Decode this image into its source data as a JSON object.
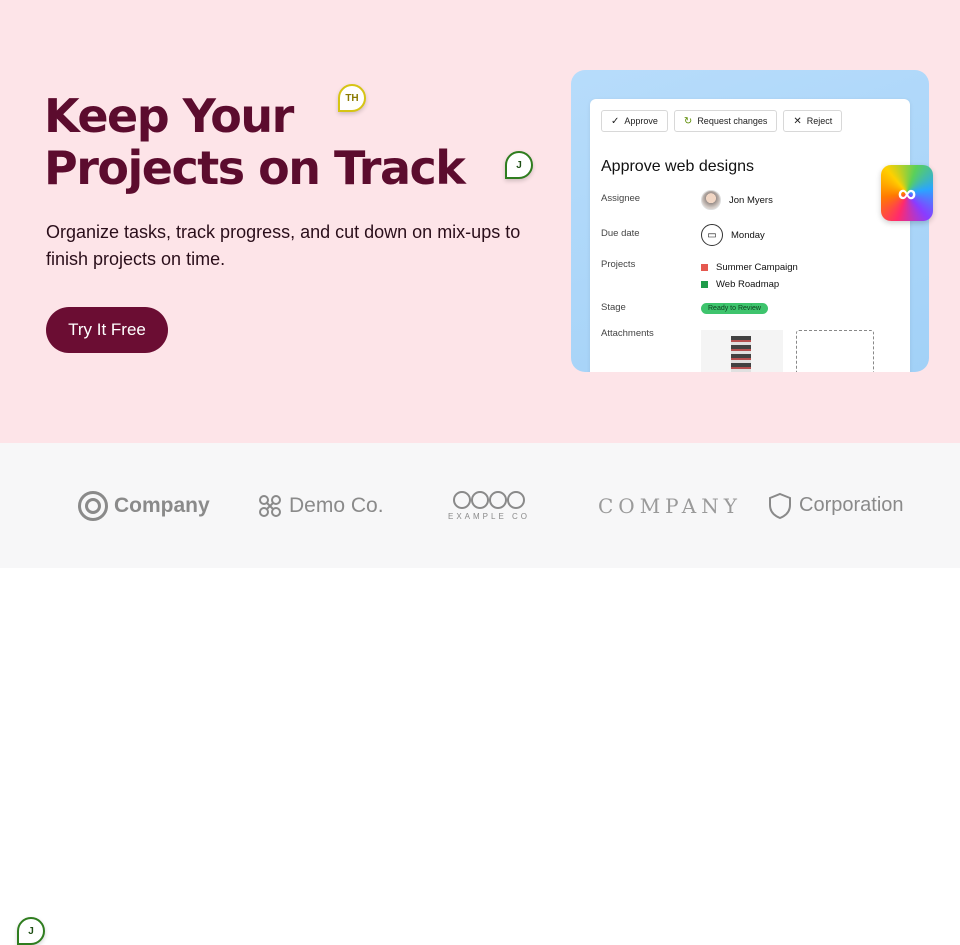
{
  "hero": {
    "headline": "Keep Your Projects on Track",
    "subtext": "Organize tasks, track progress, and cut down on mix-ups to finish projects on time.",
    "cta": "Try It Free"
  },
  "pins": {
    "th": "TH",
    "j1": "J",
    "j2": "J"
  },
  "card": {
    "actions": {
      "approve": "Approve",
      "request": "Request changes",
      "reject": "Reject"
    },
    "title": "Approve web designs",
    "assignee_label": "Assignee",
    "assignee_value": "Jon Myers",
    "due_label": "Due date",
    "due_value": "Monday",
    "projects_label": "Projects",
    "projects": [
      {
        "name": "Summer Campaign",
        "color": "#e5584f"
      },
      {
        "name": "Web Roadmap",
        "color": "#1f9c4a"
      }
    ],
    "stage_label": "Stage",
    "stage_value": "Ready to Review",
    "attachments_label": "Attachments",
    "add_symbol": "+"
  },
  "logos": {
    "l1": "Company",
    "l2": "Demo Co.",
    "l3_sub": "EXAMPLE CO",
    "l4": "COMPANY",
    "l5": "Corporation"
  },
  "colors": {
    "hero_bg": "#fde4e8",
    "brand": "#6b0d33",
    "headline": "#5c0c2e",
    "panel": "#b7dcfb",
    "stage_badge": "#3ec46d"
  }
}
